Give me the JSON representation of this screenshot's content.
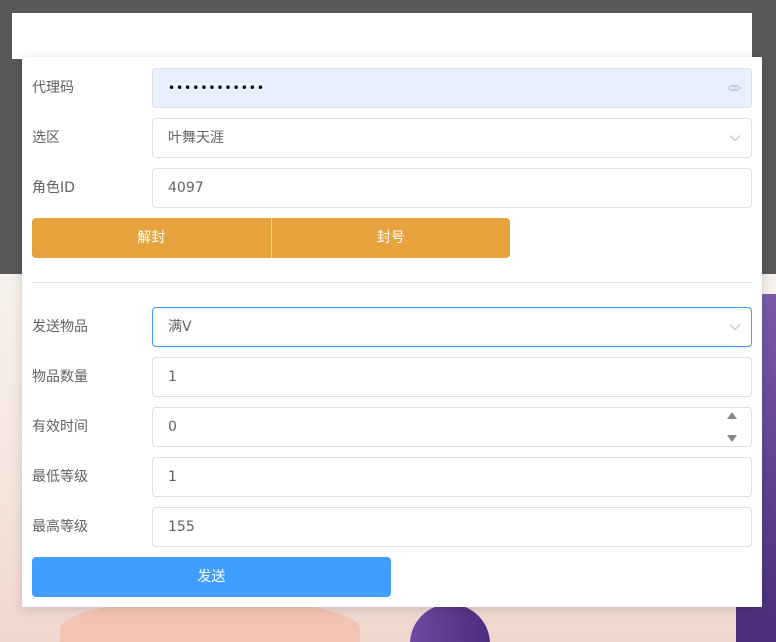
{
  "form": {
    "agent_code": {
      "label": "代理码",
      "value": "••••••••••••"
    },
    "region": {
      "label": "选区",
      "value": "叶舞天涯"
    },
    "role_id": {
      "label": "角色ID",
      "value": "4097"
    },
    "actions": {
      "unban_label": "解封",
      "ban_label": "封号"
    },
    "send_item": {
      "label": "发送物品",
      "value": "满V"
    },
    "item_count": {
      "label": "物品数量",
      "value": "1"
    },
    "valid_time": {
      "label": "有效时间",
      "value": "0"
    },
    "min_level": {
      "label": "最低等级",
      "value": "1"
    },
    "max_level": {
      "label": "最高等级",
      "value": "155"
    },
    "send_label": "发送"
  },
  "colors": {
    "orange_button": "#e6a23c",
    "blue_button": "#409eff",
    "focus_border": "#409eff",
    "autofill_bg": "#e8f0fe"
  },
  "icons": {
    "password": "eye-icon",
    "select": "chevron-down-icon",
    "stepper_up": "caret-up-icon",
    "stepper_down": "caret-down-icon"
  }
}
